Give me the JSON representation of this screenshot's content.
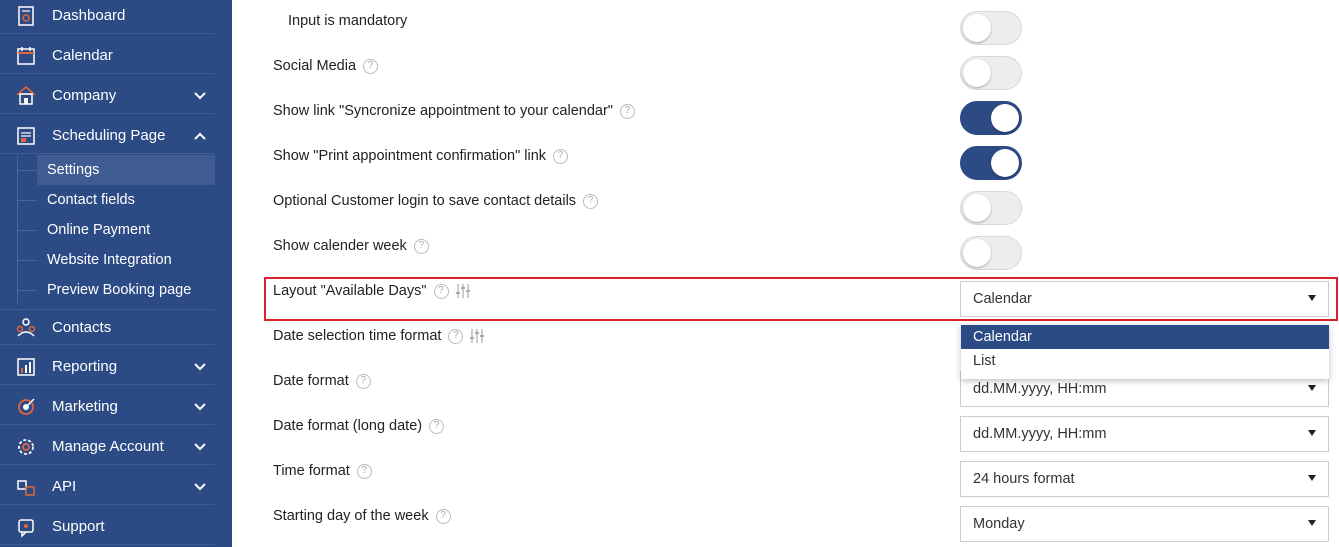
{
  "sidebar": {
    "items": [
      {
        "label": "Dashboard",
        "icon": "dashboard-icon"
      },
      {
        "label": "Calendar",
        "icon": "calendar-icon"
      },
      {
        "label": "Company",
        "icon": "company-icon",
        "chevron": "down"
      },
      {
        "label": "Scheduling Page",
        "icon": "scheduling-page-icon",
        "chevron": "up"
      },
      {
        "label": "Contacts",
        "icon": "contacts-icon"
      },
      {
        "label": "Reporting",
        "icon": "reporting-icon",
        "chevron": "down"
      },
      {
        "label": "Marketing",
        "icon": "marketing-icon",
        "chevron": "down"
      },
      {
        "label": "Manage Account",
        "icon": "manage-account-icon",
        "chevron": "down"
      },
      {
        "label": "API",
        "icon": "api-icon",
        "chevron": "down"
      },
      {
        "label": "Support",
        "icon": "support-icon"
      }
    ],
    "sub_items": [
      {
        "label": "Settings",
        "active": true
      },
      {
        "label": "Contact fields"
      },
      {
        "label": "Online Payment"
      },
      {
        "label": "Website Integration"
      },
      {
        "label": "Preview Booking page"
      }
    ]
  },
  "settings": {
    "input_mandatory": {
      "label": "Input is mandatory",
      "on": false
    },
    "social_media": {
      "label": "Social Media",
      "on": false
    },
    "sync_link": {
      "label": "Show link \"Syncronize appointment to your calendar\"",
      "on": true
    },
    "print_link": {
      "label": "Show \"Print appointment confirmation\" link",
      "on": true
    },
    "customer_login": {
      "label": "Optional Customer login to save contact details",
      "on": false
    },
    "calendar_week": {
      "label": "Show calender week",
      "on": false
    },
    "layout_days": {
      "label": "Layout \"Available Days\"",
      "value": "Calendar"
    },
    "date_selection": {
      "label": "Date selection time format"
    },
    "date_format": {
      "label": "Date format",
      "value": "dd.MM.yyyy, HH:mm"
    },
    "date_format_long": {
      "label": "Date format (long date)",
      "value": "dd.MM.yyyy, HH:mm"
    },
    "time_format": {
      "label": "Time format",
      "value": "24 hours format"
    },
    "start_day": {
      "label": "Starting day of the week",
      "value": "Monday"
    }
  },
  "dropdown": {
    "options": [
      "Calendar",
      "List"
    ],
    "selected": "Calendar"
  },
  "help_glyph": "?",
  "colors": {
    "sidebar_bg": "#2c4a84",
    "toggle_on": "#2c4a84",
    "highlight": "#d9232a"
  }
}
